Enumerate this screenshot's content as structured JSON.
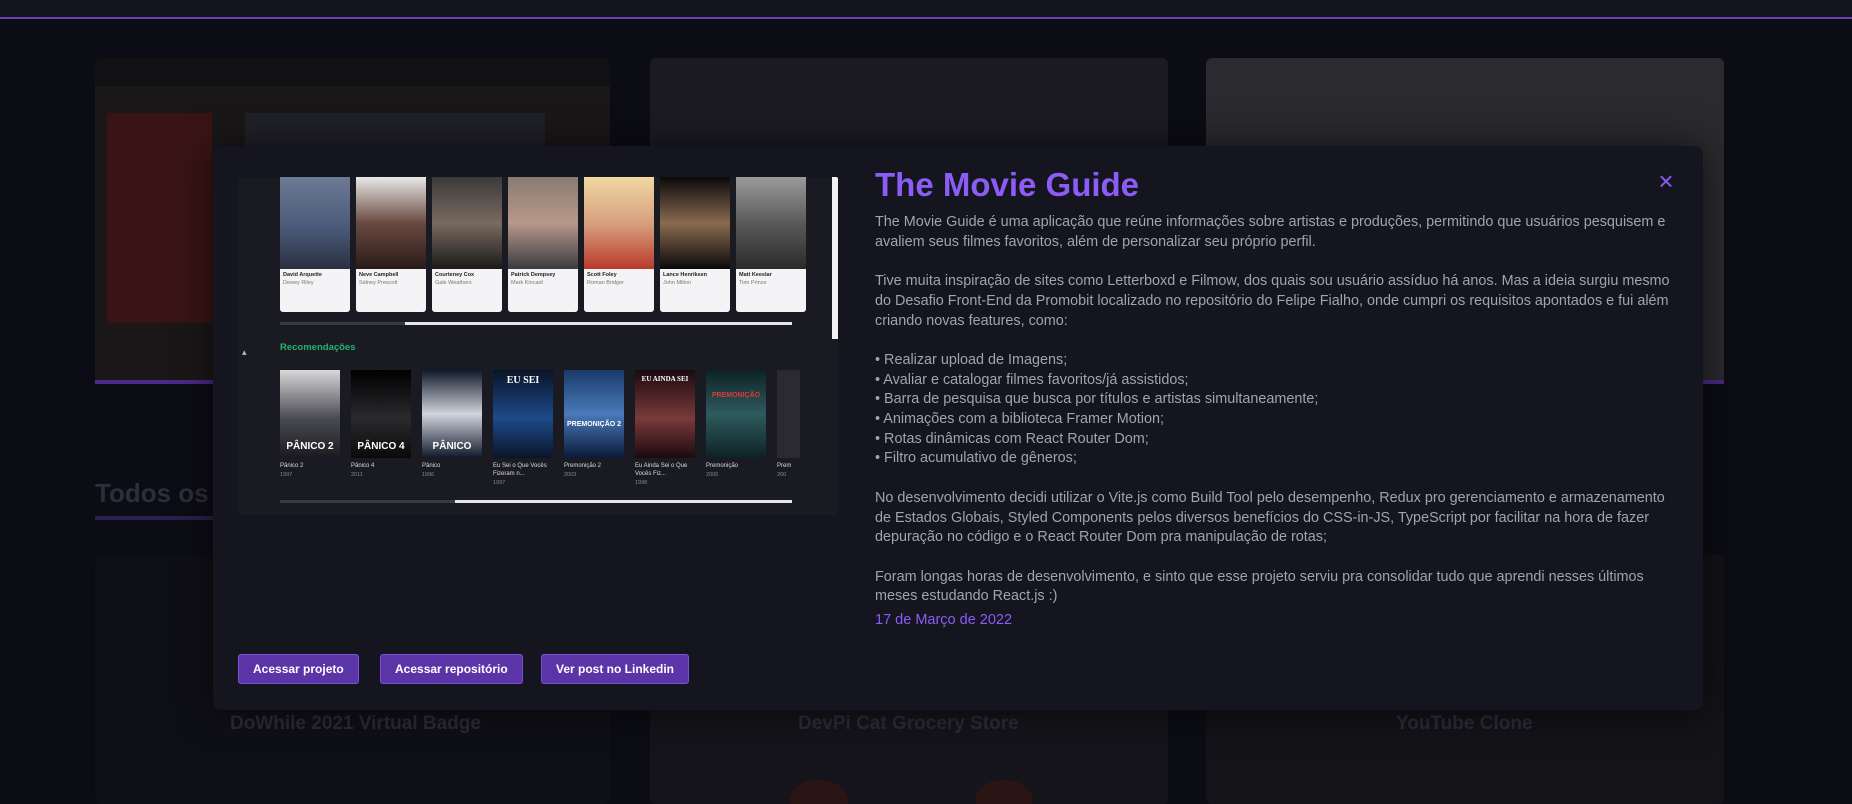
{
  "background": {
    "section_title": "Todos os p",
    "cards": [
      {
        "title": "DoWhile 2021 Virtual Badge"
      },
      {
        "title": "DevPi Cat Grocery Store"
      },
      {
        "title": "YouTube Clone"
      }
    ]
  },
  "modal": {
    "title": "The Movie Guide",
    "close_icon": "×",
    "paragraphs": [
      "The Movie Guide é uma aplicação que reúne informações sobre artistas e produções, permitindo que usuários pesquisem e avaliem seus filmes favoritos, além de personalizar seu próprio perfil.",
      "Tive muita inspiração de sites como Letterboxd e Filmow, dos quais sou usuário assíduo há anos. Mas a ideia surgiu mesmo do Desafio Front-End da Promobit localizado no repositório do Felipe Fialho, onde cumpri os requisitos apontados e fui além criando novas features, como:"
    ],
    "features": [
      "Realizar upload de Imagens;",
      "Avaliar e catalogar filmes favoritos/já assistidos;",
      "Barra de pesquisa que busca por títulos e artistas simultaneamente;",
      "Animações com a biblioteca Framer Motion;",
      "Rotas dinâmicas com React Router Dom;",
      "Filtro acumulativo de gêneros;"
    ],
    "paragraph_tech": "No desenvolvimento decidi utilizar o Vite.js como Build Tool pelo desempenho, Redux pro gerenciamento e armazenamento de Estados Globais, Styled Components pelos diversos benefícios do CSS-in-JS, TypeScript por facilitar na hora de fazer depuração no código e o React Router Dom pra manipulação de rotas;",
    "paragraph_end": "Foram longas horas de desenvolvimento, e sinto que esse projeto serviu pra consolidar tudo que aprendi nesses últimos meses estudando React.js :)",
    "date": "17 de Março de 2022",
    "buttons": {
      "project": "Acessar projeto",
      "repository": "Acessar repositório",
      "linkedin": "Ver post no Linkedin"
    },
    "accent_color": "#8b5cf6",
    "button_color": "#5b35a8"
  },
  "preview": {
    "cast": [
      {
        "name": "David Arquette",
        "role": "Dewey Riley",
        "color": "#4a5a78"
      },
      {
        "name": "Neve Campbell",
        "role": "Sidney Prescott",
        "color": "#3a2a2a"
      },
      {
        "name": "Courteney Cox",
        "role": "Gale Weathers",
        "color": "#2a2a2a"
      },
      {
        "name": "Patrick Dempsey",
        "role": "Mark Kincaid",
        "color": "#7a6c62"
      },
      {
        "name": "Scott Foley",
        "role": "Roman Bridger",
        "color": "#c84a3a"
      },
      {
        "name": "Lance Henriksen",
        "role": "John Milton",
        "color": "#1e1e1e"
      },
      {
        "name": "Matt Keeslar",
        "role": "Tom Prinze",
        "color": "#6a6a6a"
      }
    ],
    "recommendations_title": "Recomendações",
    "recommendations": [
      {
        "name": "Pânico 2",
        "year": "1997",
        "poster_text": "PÂNICO 2",
        "color": "#3a3a42"
      },
      {
        "name": "Pânico 4",
        "year": "2011",
        "poster_text": "PÂNICO 4",
        "color": "#1a1a1e"
      },
      {
        "name": "Pânico",
        "year": "1996",
        "poster_text": "PÂNICO",
        "color": "#20304a"
      },
      {
        "name": "Eu Sei o Que Vocês Fizeram n...",
        "year": "1997",
        "poster_text": "EU SEI",
        "color": "#14305a"
      },
      {
        "name": "Premonição 2",
        "year": "2003",
        "poster_text": "PREMONIÇÃO 2",
        "color": "#2a4a7a"
      },
      {
        "name": "Eu Ainda Sei o Que Vocês Fiz...",
        "year": "1998",
        "poster_text": "EU AINDA SEI",
        "color": "#3a1a22"
      },
      {
        "name": "Premonição",
        "year": "2000",
        "poster_text": "PREMONIÇÃO",
        "color": "#1e3a3e"
      },
      {
        "name": "Prem",
        "year": "200",
        "poster_text": "",
        "color": "#2a2a30"
      }
    ]
  }
}
